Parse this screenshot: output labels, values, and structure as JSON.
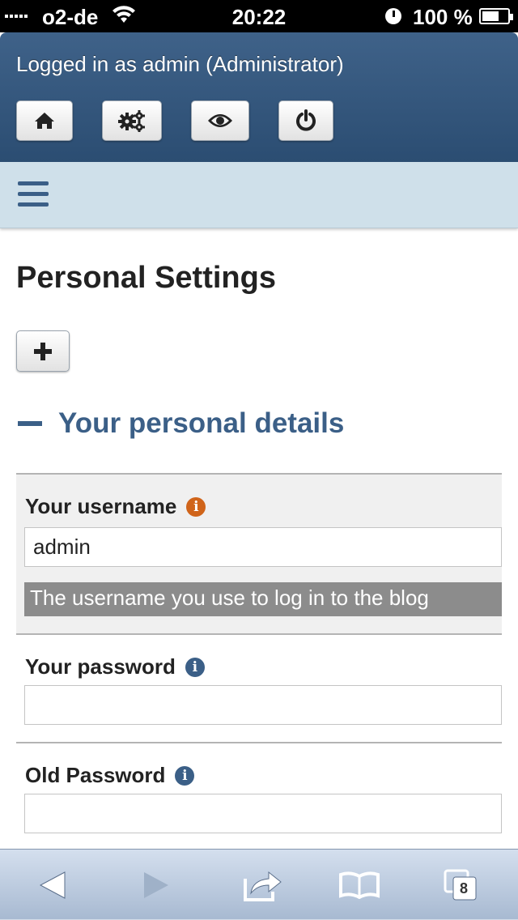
{
  "status_bar": {
    "carrier": "o2-de",
    "time": "20:22",
    "battery": "100 %"
  },
  "header": {
    "logged_in_text": "Logged in as admin (Administrator)",
    "buttons": [
      {
        "icon": "home-icon"
      },
      {
        "icon": "gears-icon"
      },
      {
        "icon": "eye-icon"
      },
      {
        "icon": "power-icon"
      }
    ]
  },
  "menu": {
    "icon": "hamburger-icon"
  },
  "page": {
    "title": "Personal Settings",
    "add_button_icon": "plus-icon",
    "section_title": "Your personal details"
  },
  "fields": {
    "username": {
      "label": "Your username",
      "value": "admin",
      "help": "The username you use to log in to the blog",
      "info_color": "#d0641a"
    },
    "password": {
      "label": "Your password",
      "value": "",
      "info_color": "#3b5f87"
    },
    "old_password": {
      "label": "Old Password",
      "value": "",
      "info_color": "#3b5f87"
    }
  },
  "toolbar": {
    "tabs_count": "8",
    "icons": [
      "back-icon",
      "forward-icon",
      "share-icon",
      "bookmarks-icon",
      "tabs-icon"
    ]
  },
  "colors": {
    "header_bg": "#2f5177",
    "menu_bg": "#cfe0ea",
    "accent": "#3b5f87",
    "help_bg": "#8c8c8c"
  }
}
